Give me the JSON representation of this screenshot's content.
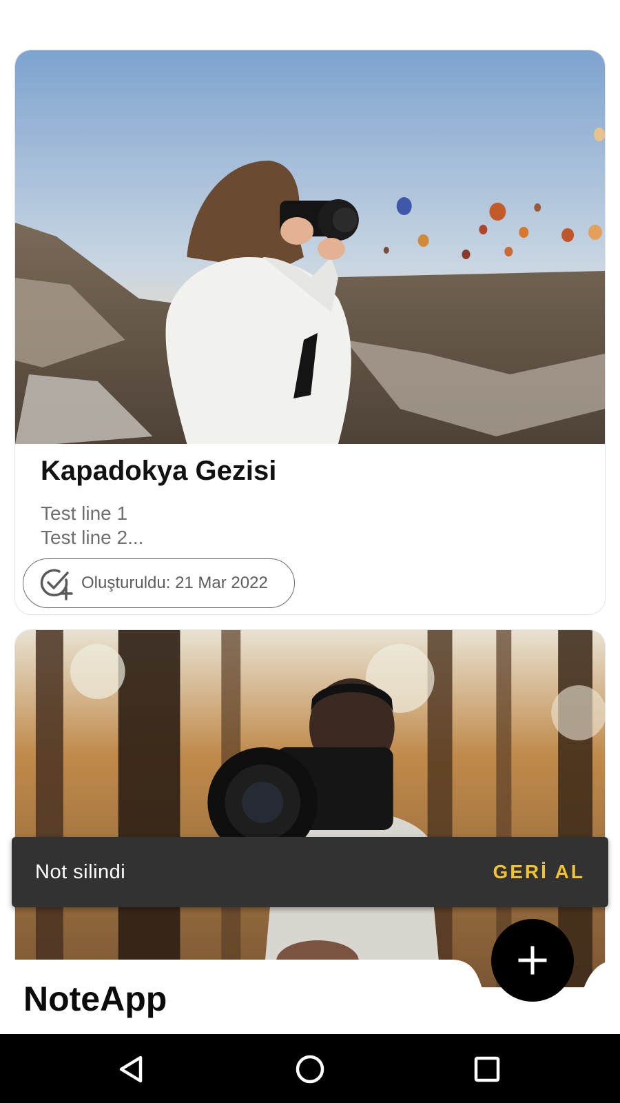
{
  "notes": [
    {
      "title": "Kapadokya Gezisi",
      "body_lines": [
        "Test line 1",
        "Test line 2..."
      ],
      "created_label": "Oluşturuldu: 21 Mar 2022",
      "image": "woman-photographer-balloons-photo"
    },
    {
      "image": "man-with-camera-forest-photo"
    }
  ],
  "snackbar": {
    "message": "Not silindi",
    "action": "GERİ AL",
    "action_color": "#f1c232"
  },
  "bottom_bar": {
    "app_title": "NoteApp",
    "fab_icon": "plus-icon"
  },
  "system_nav": {
    "icons": [
      "back-triangle-icon",
      "home-circle-icon",
      "recents-square-icon"
    ]
  },
  "colors": {
    "snackbar_bg": "#323232",
    "fab_bg": "#000000",
    "title_text": "#111111",
    "body_text": "#6f6f6f"
  }
}
